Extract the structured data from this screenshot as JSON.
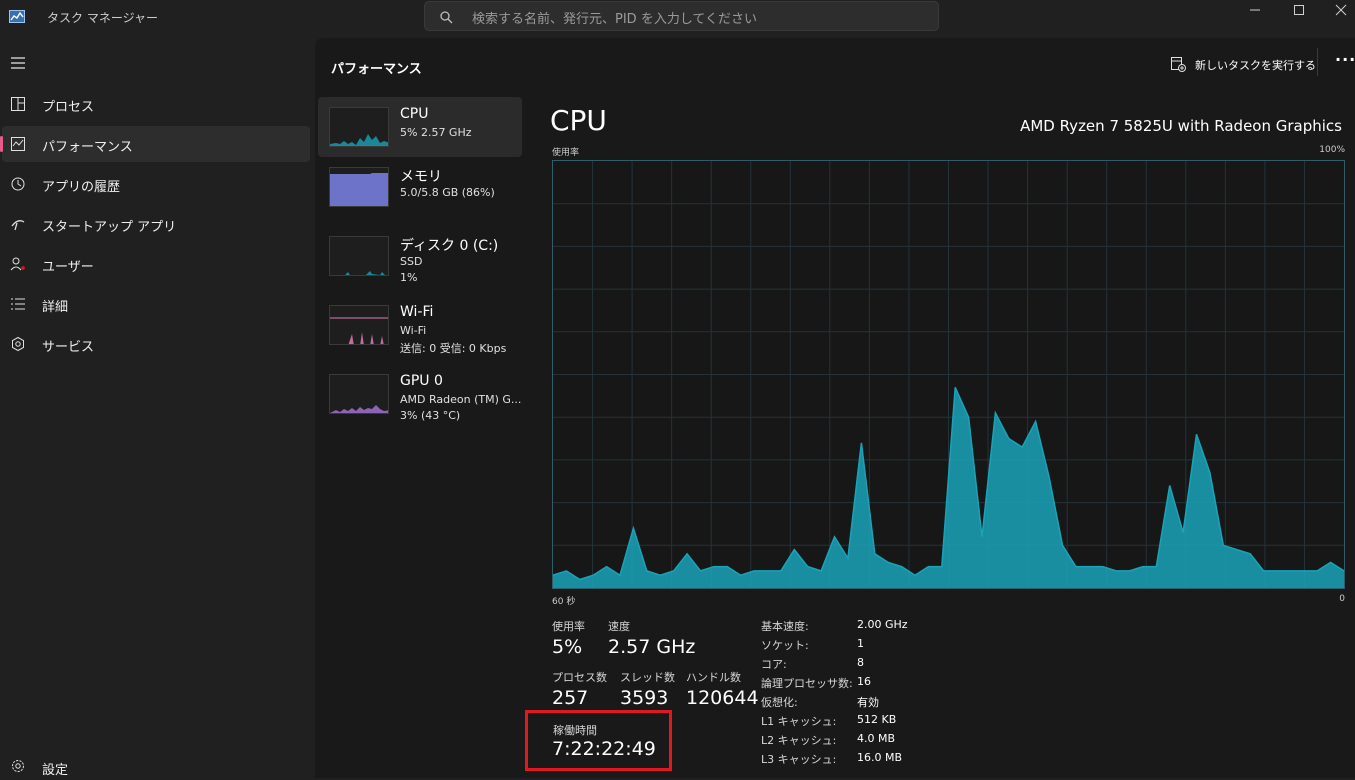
{
  "window": {
    "title": "タスク マネージャー",
    "search_placeholder": "検索する名前、発行元、PID を入力してください"
  },
  "sidebar": {
    "items": [
      {
        "label": "プロセス",
        "icon": "processes-icon"
      },
      {
        "label": "パフォーマンス",
        "icon": "performance-icon",
        "active": true
      },
      {
        "label": "アプリの履歴",
        "icon": "history-icon"
      },
      {
        "label": "スタートアップ アプリ",
        "icon": "startup-icon"
      },
      {
        "label": "ユーザー",
        "icon": "users-icon"
      },
      {
        "label": "詳細",
        "icon": "details-icon"
      },
      {
        "label": "サービス",
        "icon": "services-icon"
      }
    ],
    "settings_label": "設定"
  },
  "header": {
    "title": "パフォーマンス",
    "run_task_label": "新しいタスクを実行する",
    "more_label": "···"
  },
  "devices": [
    {
      "name": "CPU",
      "line1": "5% 2.57 GHz",
      "line2": "",
      "color": "#1aa3b8",
      "selected": true
    },
    {
      "name": "メモリ",
      "line1": "5.0/5.8 GB (86%)",
      "line2": "",
      "color": "#7b83e6"
    },
    {
      "name": "ディスク 0 (C:)",
      "line1": "SSD",
      "line2": "1%",
      "color": "#1aa3b8"
    },
    {
      "name": "Wi-Fi",
      "line1": "Wi-Fi",
      "line2": "送信: 0 受信: 0 Kbps",
      "color": "#e07ab8"
    },
    {
      "name": "GPU 0",
      "line1": "AMD Radeon (TM) G...",
      "line2": "3% (43 °C)",
      "color": "#a070d0"
    }
  ],
  "cpu_panel": {
    "heading": "CPU",
    "model": "AMD Ryzen 7 5825U with Radeon Graphics",
    "graph_top_left": "使用率",
    "graph_top_right": "100%",
    "graph_bottom_left": "60 秒",
    "graph_bottom_right": "0",
    "graph_color": "#1aa3b8",
    "usage_history_percent": [
      3,
      4,
      2,
      3,
      5,
      3,
      14,
      4,
      3,
      4,
      8,
      4,
      5,
      5,
      3,
      4,
      4,
      4,
      9,
      5,
      4,
      12,
      7,
      34,
      8,
      6,
      5,
      3,
      5,
      5,
      47,
      40,
      12,
      41,
      35,
      33,
      39,
      26,
      10,
      5,
      5,
      5,
      4,
      4,
      5,
      5,
      24,
      13,
      36,
      27,
      10,
      9,
      8,
      4,
      4,
      4,
      4,
      4,
      6,
      4
    ]
  },
  "stats": {
    "usage_label": "使用率",
    "usage_value": "5%",
    "speed_label": "速度",
    "speed_value": "2.57 GHz",
    "process_label": "プロセス数",
    "process_value": "257",
    "thread_label": "スレッド数",
    "thread_value": "3593",
    "handle_label": "ハンドル数",
    "handle_value": "120644",
    "uptime_label": "稼働時間",
    "uptime_value": "7:22:22:49"
  },
  "specs": [
    {
      "key": "基本速度:",
      "value": "2.00 GHz"
    },
    {
      "key": "ソケット:",
      "value": "1"
    },
    {
      "key": "コア:",
      "value": "8"
    },
    {
      "key": "論理プロセッサ数:",
      "value": "16"
    },
    {
      "key": "仮想化:",
      "value": "有効"
    },
    {
      "key": "L1 キャッシュ:",
      "value": "512 KB"
    },
    {
      "key": "L2 キャッシュ:",
      "value": "4.0 MB"
    },
    {
      "key": "L3 キャッシュ:",
      "value": "16.0 MB"
    }
  ]
}
